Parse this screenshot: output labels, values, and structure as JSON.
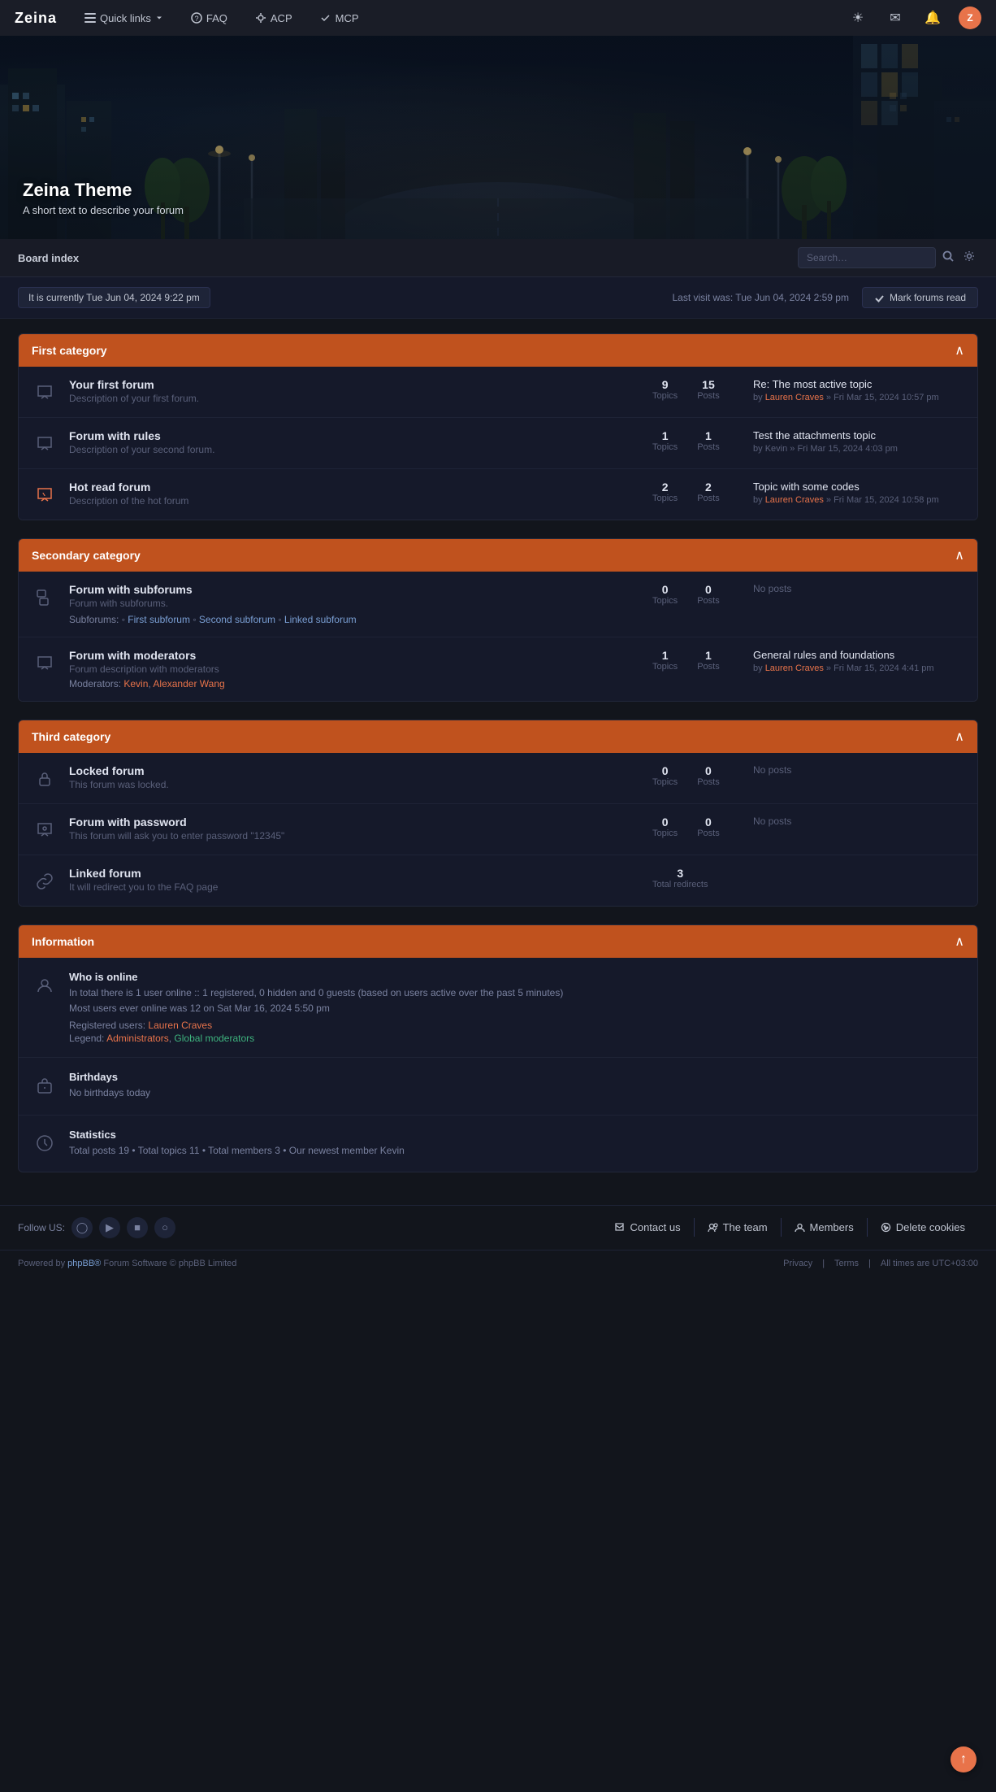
{
  "brand": "Zeina",
  "nav": {
    "quicklinks": "Quick links",
    "faq": "FAQ",
    "acp": "ACP",
    "mcp": "MCP"
  },
  "hero": {
    "title": "Zeina Theme",
    "subtitle": "A short text to describe your forum"
  },
  "breadcrumb": "Board index",
  "search": {
    "placeholder": "Search…"
  },
  "infobar": {
    "current_time": "It is currently Tue Jun 04, 2024 9:22 pm",
    "last_visit": "Last visit was: Tue Jun 04, 2024 2:59 pm",
    "mark_read": "Mark forums read"
  },
  "categories": [
    {
      "id": "first",
      "title": "First category",
      "forums": [
        {
          "name": "Your first forum",
          "desc": "Description of your first forum.",
          "topics": 9,
          "posts": 15,
          "last_title": "Re: The most active topic",
          "last_by": "Lauren Craves",
          "last_date": "» Fri Mar 15, 2024 10:57 pm",
          "type": "normal"
        },
        {
          "name": "Forum with rules",
          "desc": "Description of your second forum.",
          "topics": 1,
          "posts": 1,
          "last_title": "Test the attachments topic",
          "last_by": "Kevin",
          "last_date": "» Fri Mar 15, 2024 4:03 pm",
          "type": "normal"
        },
        {
          "name": "Hot read forum",
          "desc": "Description of the hot forum",
          "topics": 2,
          "posts": 2,
          "last_title": "Topic with some codes",
          "last_by": "Lauren Craves",
          "last_date": "» Fri Mar 15, 2024 10:58 pm",
          "type": "hot"
        }
      ]
    },
    {
      "id": "second",
      "title": "Secondary category",
      "forums": [
        {
          "name": "Forum with subforums",
          "desc": "Forum with subforums.",
          "topics": 0,
          "posts": 0,
          "last_title": "No posts",
          "last_by": "",
          "last_date": "",
          "type": "subforums",
          "subforums": [
            "First subforum",
            "Second subforum",
            "Linked subforum"
          ]
        },
        {
          "name": "Forum with moderators",
          "desc": "Forum description with moderators",
          "topics": 1,
          "posts": 1,
          "last_title": "General rules and foundations",
          "last_by": "Lauren Craves",
          "last_date": "» Fri Mar 15, 2024 4:41 pm",
          "type": "normal",
          "moderators": [
            "Kevin",
            "Alexander Wang"
          ]
        }
      ]
    },
    {
      "id": "third",
      "title": "Third category",
      "forums": [
        {
          "name": "Locked forum",
          "desc": "This forum was locked.",
          "topics": 0,
          "posts": 0,
          "last_title": "No posts",
          "last_by": "",
          "last_date": "",
          "type": "locked"
        },
        {
          "name": "Forum with password",
          "desc": "This forum will ask you to enter password \"12345\"",
          "topics": 0,
          "posts": 0,
          "last_title": "No posts",
          "last_by": "",
          "last_date": "",
          "type": "password"
        },
        {
          "name": "Linked forum",
          "desc": "It will redirect you to the FAQ page",
          "redirects": 3,
          "redirects_label": "Total redirects",
          "last_title": "",
          "type": "link"
        }
      ]
    }
  ],
  "information": {
    "title": "Information",
    "who_online": {
      "title": "Who is online",
      "text": "In total there is 1 user online :: 1 registered, 0 hidden and 0 guests (based on users active over the past 5 minutes)",
      "most_users": "Most users ever online was 12 on Sat Mar 16, 2024 5:50 pm",
      "registered_label": "Registered users:",
      "registered_user": "Lauren Craves",
      "legend_label": "Legend:",
      "legend_admins": "Administrators",
      "legend_mods": "Global moderators"
    },
    "birthdays": {
      "title": "Birthdays",
      "text": "No birthdays today"
    },
    "statistics": {
      "title": "Statistics",
      "text": "Total posts 19  •  Total topics 11  •  Total members 3  •  Our newest member Kevin"
    }
  },
  "footer": {
    "follow_label": "Follow US:",
    "links": [
      {
        "icon": "contact-icon",
        "label": "Contact us"
      },
      {
        "icon": "team-icon",
        "label": "The team"
      },
      {
        "icon": "members-icon",
        "label": "Members"
      },
      {
        "icon": "cookie-icon",
        "label": "Delete cookies"
      }
    ],
    "powered": "Powered by phpBB® Forum Software © phpBB Limited",
    "privacy": "Privacy",
    "terms": "Terms",
    "timezone": "All times are UTC+03:00"
  }
}
